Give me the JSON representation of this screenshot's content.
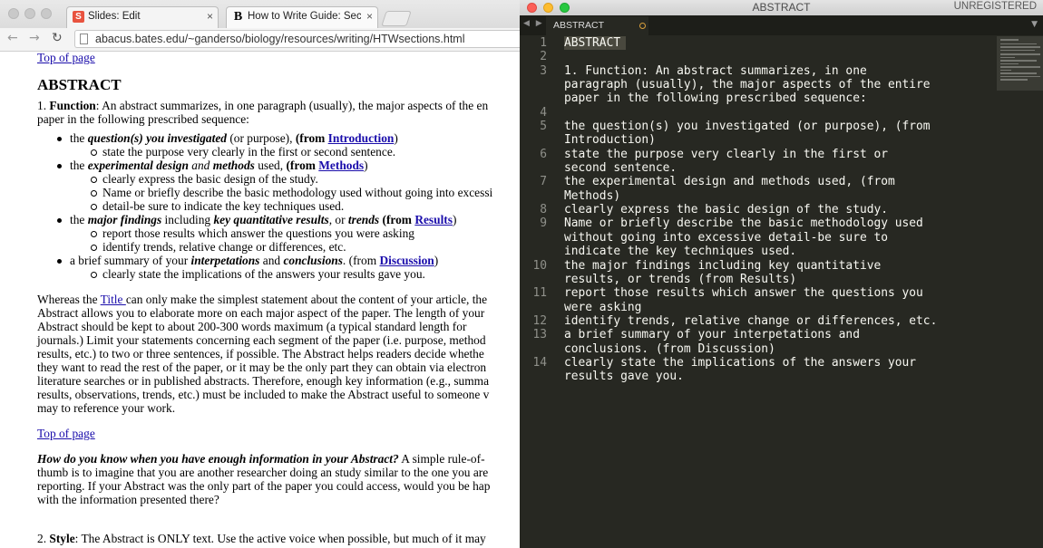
{
  "browser": {
    "tabs": [
      {
        "favicon": "S",
        "label": "Slides: Edit",
        "close": "×"
      },
      {
        "favicon": "B",
        "label": "How to Write Guide: Sectio",
        "close": "×"
      }
    ],
    "url": "abacus.bates.edu/~ganderso/biology/resources/writing/HTWsections.html",
    "nav": {
      "back": "←",
      "forward": "→",
      "reload": "↻"
    }
  },
  "page": {
    "top_link": "Top of page",
    "heading": "ABSTRACT",
    "p1": {
      "num": "1. ",
      "label": "Function",
      "line1": ": An abstract summarizes, in one paragraph (usually), the major aspects of the en",
      "line2": "paper in the following prescribed sequence:"
    },
    "bullets": {
      "b1": {
        "pre": "the ",
        "em": "question(s) you investigated",
        "mid": " (or purpose), ",
        "from": "(from ",
        "link": "Introduction",
        "close": ")"
      },
      "b1_sub": [
        "state the purpose very clearly in the first or second sentence."
      ],
      "b2": {
        "pre": "the ",
        "em": "experimental design",
        "and": " and ",
        "em2": "methods",
        "mid": " used, ",
        "from": "(from ",
        "link": "Methods",
        "close": ")"
      },
      "b2_sub": [
        "clearly express the basic design of the study.",
        "Name or briefly describe the basic methodology used without going into excessi",
        "detail-be sure to indicate the key techniques used."
      ],
      "b3": {
        "pre": "the ",
        "em": "major findings",
        "mid": " including ",
        "em2": "key quantitative results",
        "or": ", or ",
        "em3": "trends",
        "from": " (from ",
        "link": "Results",
        "close": ")"
      },
      "b3_sub": [
        "report those results which answer the questions you were asking",
        "identify trends, relative change or differences, etc."
      ],
      "b4": {
        "pre": "a brief summary of your ",
        "em": "interpetations",
        "and": " and ",
        "em2": "conclusions",
        "from": ". (from ",
        "link": "Discussion",
        "close": ")"
      },
      "b4_sub": [
        "clearly state the implications of the answers your results gave you."
      ]
    },
    "p2": {
      "pre": "Whereas the ",
      "link": "Title ",
      "post": "can only make the simplest statement about the content of your article, the",
      "lines": [
        "Abstract allows you to elaborate more on each major aspect of the paper. The length of your",
        "Abstract should be kept to about 200-300 words maximum (a typical standard length for",
        "journals.) Limit your statements concerning each segment of the paper (i.e. purpose, method",
        "results, etc.) to two or three sentences, if possible. The Abstract helps readers decide whethe",
        "they want to read the rest of the paper, or it may be the only part they can obtain via electron",
        "literature searches or in published abstracts. Therefore, enough key information (e.g., summa",
        "results, observations, trends, etc.) must be included to make the Abstract useful to someone v",
        "may to reference your work."
      ]
    },
    "top_link2": "Top of page",
    "p3": {
      "q": "How do you know when you have enough information in your Abstract?",
      "line1": " A simple rule-of-",
      "lines": [
        "thumb is to imagine that you are another researcher doing an study similar to the one you are",
        "reporting. If your Abstract was the only part of the paper you could access, would you be hap",
        "with the information presented there?"
      ]
    },
    "p4": {
      "num": "2. ",
      "label": "Style",
      "text": ": The Abstract is ONLY text. Use the active voice when possible, but much of it may"
    }
  },
  "editor": {
    "window_title": "ABSTRACT",
    "license": "UNREGISTERED",
    "tab_label": "ABSTRACT",
    "tab_arrows": "◀ ▶",
    "tab_menu": "▼",
    "lines": [
      {
        "n": "1",
        "rows": [
          "ABSTRACT"
        ]
      },
      {
        "n": "2",
        "rows": [
          ""
        ]
      },
      {
        "n": "3",
        "rows": [
          "1. Function: An abstract summarizes, in one",
          "paragraph (usually), the major aspects of the entire",
          "paper in the following prescribed sequence:"
        ]
      },
      {
        "n": "4",
        "rows": [
          ""
        ]
      },
      {
        "n": "5",
        "rows": [
          "the question(s) you investigated (or purpose), (from",
          "Introduction)"
        ]
      },
      {
        "n": "6",
        "rows": [
          "state the purpose very clearly in the first or",
          "second sentence."
        ]
      },
      {
        "n": "7",
        "rows": [
          "the experimental design and methods used, (from",
          "Methods)"
        ]
      },
      {
        "n": "8",
        "rows": [
          "clearly express the basic design of the study."
        ]
      },
      {
        "n": "9",
        "rows": [
          "Name or briefly describe the basic methodology used",
          "without going into excessive detail-be sure to",
          "indicate the key techniques used."
        ]
      },
      {
        "n": "10",
        "rows": [
          "the major findings including key quantitative",
          "results, or trends (from Results)"
        ]
      },
      {
        "n": "11",
        "rows": [
          "report those results which answer the questions you",
          "were asking"
        ]
      },
      {
        "n": "12",
        "rows": [
          "identify trends, relative change or differences, etc."
        ]
      },
      {
        "n": "13",
        "rows": [
          "a brief summary of your interpetations and",
          "conclusions. (from Discussion)"
        ]
      },
      {
        "n": "14",
        "rows": [
          "clearly state the implications of the answers your",
          "results gave you."
        ]
      }
    ]
  },
  "colors": {
    "editor_bg": "#272822",
    "link": "#1a0dab",
    "close_dot": "#fc5f57",
    "min_dot": "#fdbc2e",
    "max_dot": "#28c840",
    "modified_dot": "#d9a03c"
  }
}
